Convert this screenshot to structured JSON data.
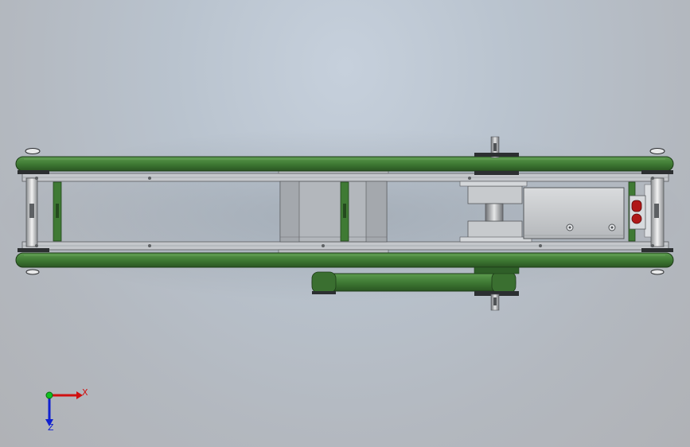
{
  "viewport": {
    "background_top": "#c6d0dc",
    "background_bottom": "#b0b2b6"
  },
  "model": {
    "belt_color": "#3f7a34",
    "belt_dark": "#2c5a25",
    "frame_color": "#b8bcc2",
    "motor_color": "#c9cbce",
    "sensor_color": "#b01818"
  },
  "triad": {
    "x_label": "X",
    "z_label": "Z",
    "x_color": "#d01010",
    "y_color": "#10c020",
    "z_color": "#1020d0"
  }
}
